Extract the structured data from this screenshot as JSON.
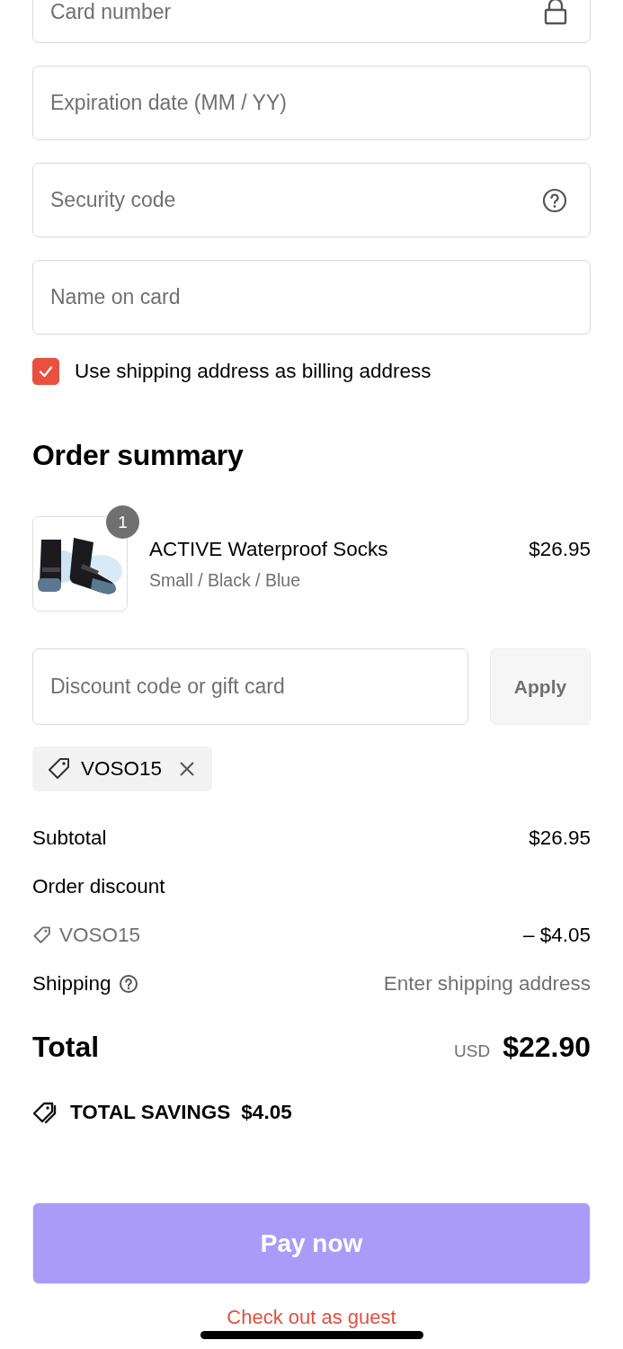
{
  "payment_fields": [
    {
      "placeholder": "Card number",
      "kind": "lock"
    },
    {
      "placeholder": "Expiration date (MM / YY)",
      "kind": "plain"
    },
    {
      "placeholder": "Security code",
      "kind": "help"
    },
    {
      "placeholder": "Name on card",
      "kind": "plain"
    }
  ],
  "billing_checkbox": {
    "label": "Use shipping address as billing address",
    "checked": true
  },
  "order_summary": {
    "title": "Order summary",
    "items": [
      {
        "name": "ACTIVE Waterproof Socks",
        "variant": "Small / Black / Blue",
        "price": "$26.95",
        "quantity": "1"
      }
    ],
    "discount": {
      "placeholder": "Discount code or gift card",
      "button": "Apply"
    },
    "applied_codes": [
      {
        "code": "VOSO15"
      }
    ],
    "subtotal": {
      "label": "Subtotal",
      "value": "$26.95"
    },
    "order_discount": {
      "label": "Order discount",
      "code": "VOSO15",
      "amount": "– $4.05"
    },
    "shipping": {
      "label": "Shipping",
      "value": "Enter shipping address"
    },
    "total": {
      "label": "Total",
      "currency": "USD",
      "amount": "$22.90"
    },
    "savings": {
      "label": "TOTAL SAVINGS",
      "amount": "$4.05"
    }
  },
  "pay_button": "Pay now",
  "guest_link": "Check out as guest"
}
